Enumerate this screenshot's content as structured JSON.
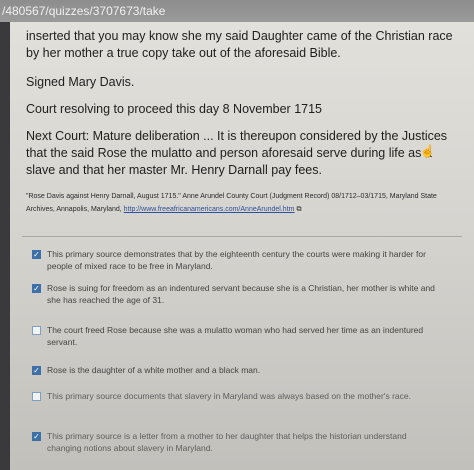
{
  "browser": {
    "url": "/480567/quizzes/3707673/take"
  },
  "document": {
    "para1": "inserted that you may know she my said Daughter came of the Christian race by her mother a true copy take out of the aforesaid Bible.",
    "para2": "Signed Mary Davis.",
    "para3": "Court resolving to proceed this day 8 November 1715",
    "para4": "Next Court: Mature deliberation ... It is thereupon considered by the Justices that the said Rose the mulatto and person aforesaid serve during life as a slave and that her master Mr. Henry Darnall pay fees.",
    "citation_text": "\"Rose Davis against Henry Darnall, August 1715.\" Anne Arundel County Court (Judgment Record) 08/1712–03/1715, Maryland State Archives, Annapolis, Maryland,",
    "citation_link": "http://www.freeafricanamericans.com/AnneArundel.htm"
  },
  "options": [
    {
      "label": "This primary source demonstrates that by the eighteenth century the courts were making it harder for people of mixed race to be free in Maryland.",
      "checked": true
    },
    {
      "label": "Rose is suing for freedom as an indentured servant because she is a Christian, her mother is white and she has reached the age of 31.",
      "checked": true
    },
    {
      "label": "The court freed Rose because she was a mulatto woman who had served her time as an indentured servant.",
      "checked": false
    },
    {
      "label": "Rose is the daughter of a white mother and a black man.",
      "checked": true
    },
    {
      "label": "This primary source documents that slavery in Maryland was always based on the mother's race.",
      "checked": false
    },
    {
      "label": "This primary source is a letter from a mother to her daughter that helps the historian understand changing notions about slavery in Maryland.",
      "checked": true
    }
  ],
  "colors": {
    "checkbox_checked": "#3d6fa8",
    "link": "#2e4f9c"
  }
}
